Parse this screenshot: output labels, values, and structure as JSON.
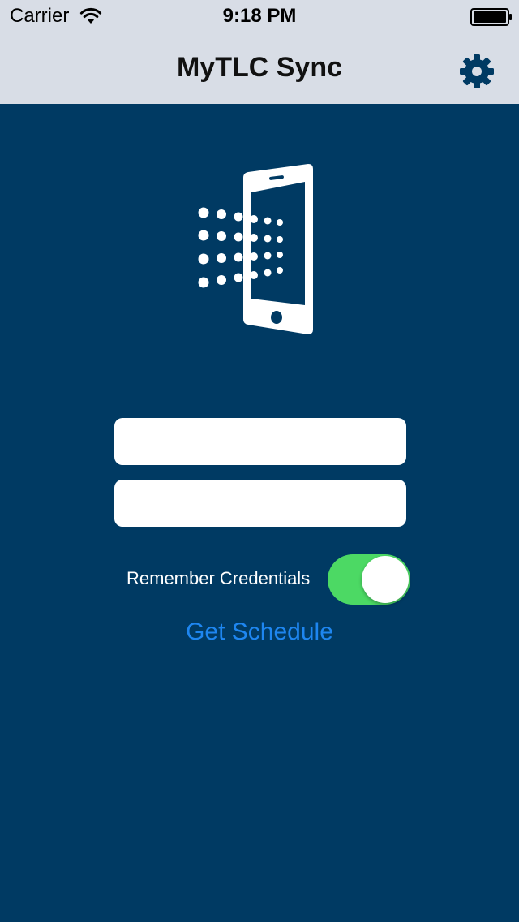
{
  "status_bar": {
    "carrier": "Carrier",
    "time": "9:18 PM",
    "wifi_icon": "wifi-icon",
    "battery_icon": "battery-icon"
  },
  "nav": {
    "title": "MyTLC Sync",
    "settings_icon": "gear-icon"
  },
  "logo": {
    "icon": "phone-sync-icon"
  },
  "form": {
    "username": {
      "value": "",
      "placeholder": ""
    },
    "password": {
      "value": "",
      "placeholder": ""
    },
    "remember_label": "Remember Credentials",
    "remember_on": true,
    "submit_label": "Get Schedule"
  },
  "colors": {
    "background": "#003a63",
    "nav_bar": "#d8dde6",
    "toggle_on": "#4cd964",
    "link": "#1e86f0"
  }
}
